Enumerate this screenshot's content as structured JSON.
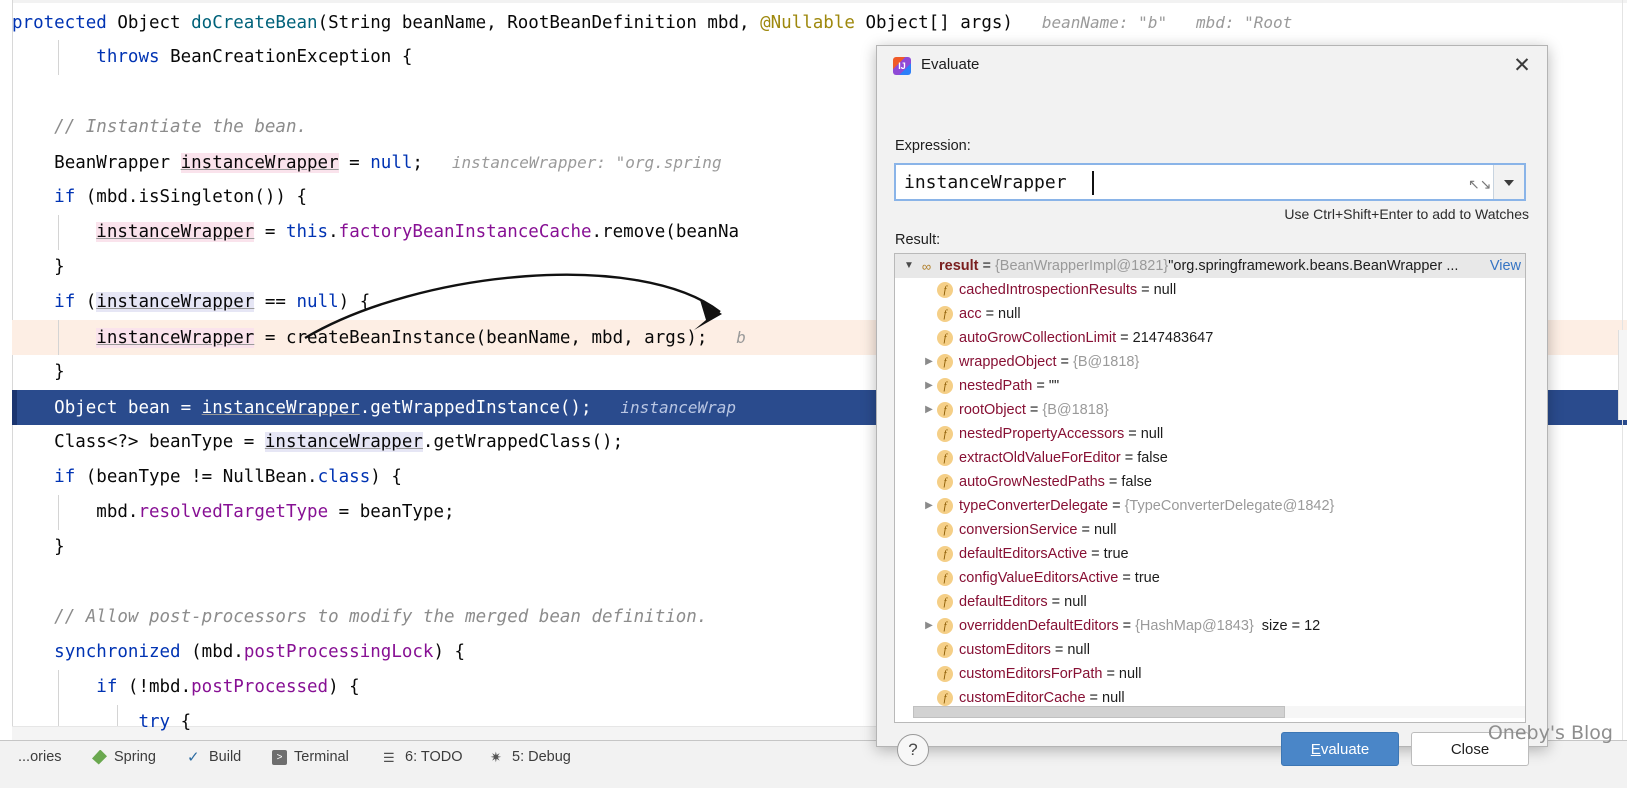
{
  "editor": {
    "lines": [
      {
        "id": 1,
        "segments": [
          {
            "t": "protected ",
            "c": "kw"
          },
          {
            "t": "Object ",
            "c": "txt"
          },
          {
            "t": "doCreateBean",
            "c": "fn"
          },
          {
            "t": "(String beanName, RootBeanDefinition mbd, ",
            "c": "txt"
          },
          {
            "t": "@Nullable ",
            "c": "ann"
          },
          {
            "t": "Object[] args)",
            "c": "txt"
          },
          {
            "t": "   beanName: \"b\"   mbd: \"Root",
            "c": "hint"
          }
        ]
      },
      {
        "id": 2,
        "indent": 8,
        "segments": [
          {
            "t": "throws ",
            "c": "kw"
          },
          {
            "t": "BeanCreationException {",
            "c": "txt"
          }
        ]
      },
      {
        "id": 3,
        "segments": []
      },
      {
        "id": 4,
        "indent": 4,
        "segments": [
          {
            "t": "// Instantiate the bean.",
            "c": "cmt"
          }
        ]
      },
      {
        "id": 5,
        "indent": 4,
        "segments": [
          {
            "t": "BeanWrapper ",
            "c": "txt"
          },
          {
            "t": "instanceWrapper",
            "c": "txt hl-pink uline"
          },
          {
            "t": " = ",
            "c": "txt"
          },
          {
            "t": "null",
            "c": "kw"
          },
          {
            "t": ";",
            "c": "txt"
          },
          {
            "t": "   instanceWrapper: \"org.spring",
            "c": "hint"
          }
        ]
      },
      {
        "id": 6,
        "indent": 4,
        "segments": [
          {
            "t": "if ",
            "c": "kw"
          },
          {
            "t": "(mbd.isSingleton()) {",
            "c": "txt"
          }
        ]
      },
      {
        "id": 7,
        "indent": 8,
        "segments": [
          {
            "t": "instanceWrapper",
            "c": "txt hl-pink uline"
          },
          {
            "t": " = ",
            "c": "txt"
          },
          {
            "t": "this",
            "c": "kw"
          },
          {
            "t": ".",
            "c": "txt"
          },
          {
            "t": "factoryBeanInstanceCache",
            "c": "fld"
          },
          {
            "t": ".remove(beanNa",
            "c": "txt"
          }
        ]
      },
      {
        "id": 8,
        "indent": 4,
        "segments": [
          {
            "t": "}",
            "c": "txt"
          }
        ]
      },
      {
        "id": 9,
        "indent": 4,
        "segments": [
          {
            "t": "if ",
            "c": "kw"
          },
          {
            "t": "(",
            "c": "txt"
          },
          {
            "t": "instanceWrapper",
            "c": "txt hl-lav uline"
          },
          {
            "t": " == ",
            "c": "txt"
          },
          {
            "t": "null",
            "c": "kw"
          },
          {
            "t": ") {",
            "c": "txt"
          }
        ]
      },
      {
        "id": 10,
        "indent": 8,
        "rowStyle": "exec",
        "segments": [
          {
            "t": "instanceWrapper",
            "c": "txt hl-pink uline"
          },
          {
            "t": " = createBeanInstance(beanName, mbd, args);",
            "c": "txt"
          },
          {
            "t": "   b",
            "c": "hint"
          }
        ]
      },
      {
        "id": 11,
        "indent": 4,
        "segments": [
          {
            "t": "}",
            "c": "txt"
          }
        ]
      },
      {
        "id": 12,
        "indent": 4,
        "rowStyle": "selected",
        "segments": [
          {
            "t": "Object bean = ",
            "c": "sel-txt"
          },
          {
            "t": "instanceWrapper",
            "c": "sel-txt uline"
          },
          {
            "t": ".getWrappedInstance();",
            "c": "sel-txt"
          },
          {
            "t": "   instanceWrap",
            "c": "sel-hint"
          }
        ]
      },
      {
        "id": 13,
        "indent": 4,
        "segments": [
          {
            "t": "Class<?> beanType = ",
            "c": "txt"
          },
          {
            "t": "instanceWrapper",
            "c": "txt hl-lav uline"
          },
          {
            "t": ".getWrappedClass();",
            "c": "txt"
          }
        ]
      },
      {
        "id": 14,
        "indent": 4,
        "segments": [
          {
            "t": "if ",
            "c": "kw"
          },
          {
            "t": "(beanType != NullBean.",
            "c": "txt"
          },
          {
            "t": "class",
            "c": "kw"
          },
          {
            "t": ") {",
            "c": "txt"
          }
        ]
      },
      {
        "id": 15,
        "indent": 8,
        "segments": [
          {
            "t": "mbd.",
            "c": "txt"
          },
          {
            "t": "resolvedTargetType",
            "c": "fld"
          },
          {
            "t": " = beanType;",
            "c": "txt"
          }
        ]
      },
      {
        "id": 16,
        "indent": 4,
        "segments": [
          {
            "t": "}",
            "c": "txt"
          }
        ]
      },
      {
        "id": 17,
        "segments": []
      },
      {
        "id": 18,
        "indent": 4,
        "segments": [
          {
            "t": "// Allow post-processors to modify the merged bean definition.",
            "c": "cmt"
          }
        ]
      },
      {
        "id": 19,
        "indent": 4,
        "segments": [
          {
            "t": "synchronized ",
            "c": "kw"
          },
          {
            "t": "(mbd.",
            "c": "txt"
          },
          {
            "t": "postProcessingLock",
            "c": "fld"
          },
          {
            "t": ") {",
            "c": "txt"
          }
        ]
      },
      {
        "id": 20,
        "indent": 8,
        "segments": [
          {
            "t": "if ",
            "c": "kw"
          },
          {
            "t": "(!mbd.",
            "c": "txt"
          },
          {
            "t": "postProcessed",
            "c": "fld"
          },
          {
            "t": ") {",
            "c": "txt"
          }
        ]
      },
      {
        "id": 21,
        "indent": 12,
        "segments": [
          {
            "t": "try ",
            "c": "kw"
          },
          {
            "t": "{",
            "c": "txt"
          }
        ]
      }
    ]
  },
  "toolwindows": {
    "items": [
      {
        "label": "...ories",
        "icon": "none"
      },
      {
        "label": "Spring",
        "icon": "spring-icon"
      },
      {
        "label": "Build",
        "icon": "build-icon"
      },
      {
        "label": "Terminal",
        "icon": "terminal-icon"
      },
      {
        "label": "6: TODO",
        "icon": "todo-icon"
      },
      {
        "label": "5: Debug",
        "icon": "debug-icon"
      }
    ]
  },
  "dialog": {
    "title": "Evaluate",
    "title_icon": "intellij-idea-icon",
    "close_icon": "close-icon",
    "expression_label": "Expression:",
    "expression_value": "instanceWrapper",
    "expression_placeholder": "",
    "expand_icon": "expand-icon",
    "dropdown_icon": "chevron-down-icon",
    "hint": "Use Ctrl+Shift+Enter to add to Watches",
    "result_label": "Result:",
    "view_link": "View",
    "help_label": "?",
    "evaluate_button": "Evaluate",
    "evaluate_button_mnemonic": "E",
    "evaluate_button_rest": "valuate",
    "close_button": "Close",
    "tree": [
      {
        "depth": 0,
        "expander": "expanded",
        "icon": "result-icon",
        "name": "result",
        "eq": "=",
        "type": "{BeanWrapperImpl@1821}",
        "value": "\"org.springframework.beans.BeanWrapper ...",
        "root": true
      },
      {
        "depth": 1,
        "expander": "none",
        "icon": "field-icon",
        "name": "cachedIntrospectionResults",
        "eq": "=",
        "value": "null"
      },
      {
        "depth": 1,
        "expander": "none",
        "icon": "field-icon",
        "name": "acc",
        "eq": "=",
        "value": "null"
      },
      {
        "depth": 1,
        "expander": "none",
        "icon": "field-icon",
        "name": "autoGrowCollectionLimit",
        "eq": "=",
        "value": "2147483647"
      },
      {
        "depth": 1,
        "expander": "collapsed",
        "icon": "field-icon",
        "name": "wrappedObject",
        "eq": "=",
        "type": "{B@1818}"
      },
      {
        "depth": 1,
        "expander": "collapsed",
        "icon": "field-icon",
        "name": "nestedPath",
        "eq": "=",
        "value": "\"\""
      },
      {
        "depth": 1,
        "expander": "collapsed",
        "icon": "field-icon",
        "name": "rootObject",
        "eq": "=",
        "type": "{B@1818}"
      },
      {
        "depth": 1,
        "expander": "none",
        "icon": "field-icon",
        "name": "nestedPropertyAccessors",
        "eq": "=",
        "value": "null"
      },
      {
        "depth": 1,
        "expander": "none",
        "icon": "field-icon",
        "name": "extractOldValueForEditor",
        "eq": "=",
        "value": "false"
      },
      {
        "depth": 1,
        "expander": "none",
        "icon": "field-icon",
        "name": "autoGrowNestedPaths",
        "eq": "=",
        "value": "false"
      },
      {
        "depth": 1,
        "expander": "collapsed",
        "icon": "field-icon",
        "name": "typeConverterDelegate",
        "eq": "=",
        "type": "{TypeConverterDelegate@1842}"
      },
      {
        "depth": 1,
        "expander": "none",
        "icon": "field-icon",
        "name": "conversionService",
        "eq": "=",
        "value": "null"
      },
      {
        "depth": 1,
        "expander": "none",
        "icon": "field-icon",
        "name": "defaultEditorsActive",
        "eq": "=",
        "value": "true"
      },
      {
        "depth": 1,
        "expander": "none",
        "icon": "field-icon",
        "name": "configValueEditorsActive",
        "eq": "=",
        "value": "true"
      },
      {
        "depth": 1,
        "expander": "none",
        "icon": "field-icon",
        "name": "defaultEditors",
        "eq": "=",
        "value": "null"
      },
      {
        "depth": 1,
        "expander": "collapsed",
        "icon": "field-icon",
        "name": "overriddenDefaultEditors",
        "eq": "=",
        "type": "{HashMap@1843}",
        "size": "size = 12"
      },
      {
        "depth": 1,
        "expander": "none",
        "icon": "field-icon",
        "name": "customEditors",
        "eq": "=",
        "value": "null"
      },
      {
        "depth": 1,
        "expander": "none",
        "icon": "field-icon",
        "name": "customEditorsForPath",
        "eq": "=",
        "value": "null"
      },
      {
        "depth": 1,
        "expander": "none",
        "icon": "field-icon",
        "name": "customEditorCache",
        "eq": "=",
        "value": "null"
      }
    ]
  },
  "watermark": "Oneby's Blog",
  "colors": {
    "accent_blue": "#4a86c8",
    "selection_blue": "#2a4b8d",
    "exec_line": "#fdeee4",
    "keyword": "#0033b3",
    "field": "#871094",
    "comment": "#8c8c8c",
    "annotation": "#9e880d",
    "tree_name": "#871034",
    "link": "#3574c4"
  }
}
